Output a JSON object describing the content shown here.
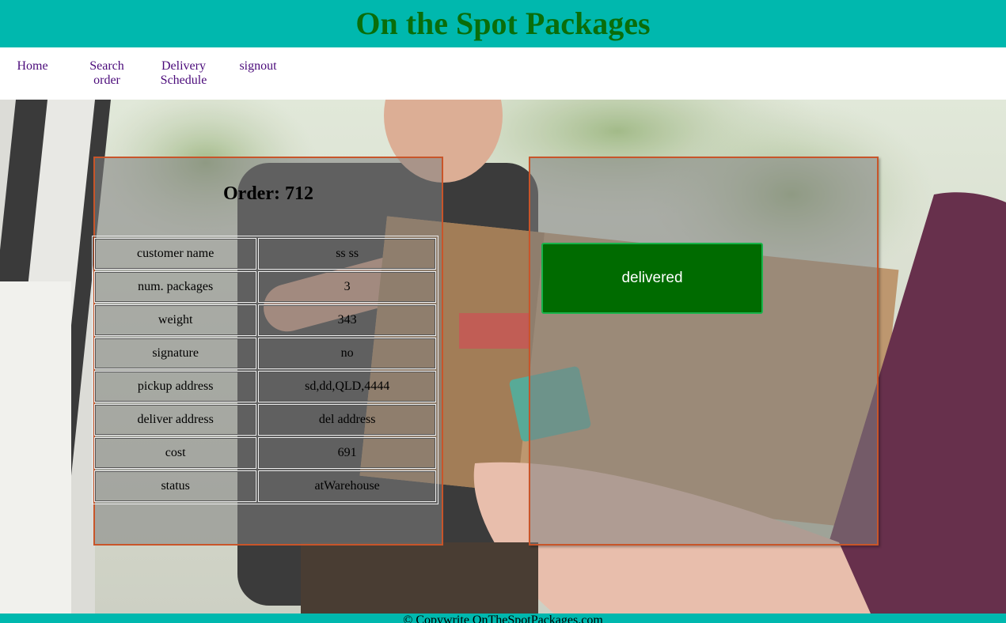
{
  "header": {
    "title": "On the Spot Packages"
  },
  "nav": {
    "home": "Home",
    "search_order_line1": "Search",
    "search_order_line2": "order",
    "delivery_schedule_line1": "Delivery",
    "delivery_schedule_line2": "Schedule",
    "signout": "signout"
  },
  "order": {
    "title": "Order: 712",
    "rows": [
      {
        "label": "customer name",
        "value": "ss ss"
      },
      {
        "label": "num. packages",
        "value": "3"
      },
      {
        "label": "weight",
        "value": "343"
      },
      {
        "label": "signature",
        "value": "no"
      },
      {
        "label": "pickup address",
        "value": "sd,dd,QLD,4444"
      },
      {
        "label": "deliver address",
        "value": "del address"
      },
      {
        "label": "cost",
        "value": "691"
      },
      {
        "label": "status",
        "value": "atWarehouse"
      }
    ]
  },
  "actions": {
    "status_button_label": "delivered"
  },
  "footer": {
    "text": "© Copywrite OnTheSpotPackages.com"
  },
  "colors": {
    "header_bg": "#00b8ae",
    "title_text": "#0a6d0a",
    "nav_link": "#4a0a7a",
    "panel_border": "#c8552a",
    "button_bg": "#006b00",
    "button_border": "#19b34a"
  },
  "background_image": "delivery person handing a cardboard package to a customer"
}
